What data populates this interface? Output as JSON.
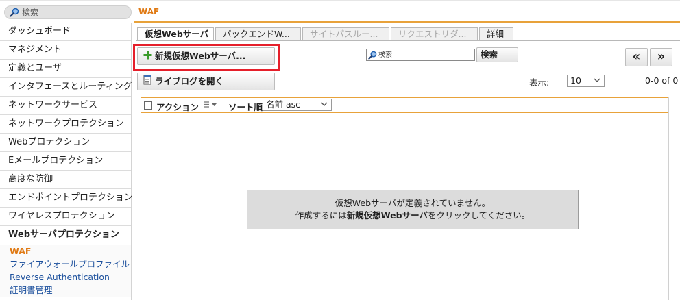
{
  "search": {
    "placeholder": "検索"
  },
  "page_title": "WAF",
  "sidebar": {
    "items": [
      {
        "label": "ダッシュボード"
      },
      {
        "label": "マネジメント"
      },
      {
        "label": "定義とユーザ"
      },
      {
        "label": "インタフェースとルーティング"
      },
      {
        "label": "ネットワークサービス"
      },
      {
        "label": "ネットワークプロテクション"
      },
      {
        "label": "Webプロテクション"
      },
      {
        "label": "Eメールプロテクション"
      },
      {
        "label": "高度な防御"
      },
      {
        "label": "エンドポイントプロテクション"
      },
      {
        "label": "ワイヤレスプロテクション"
      },
      {
        "label": "Webサーバプロテクション"
      }
    ],
    "subitems": [
      {
        "label": "WAF"
      },
      {
        "label": "ファイアウォールプロファイル"
      },
      {
        "label": "Reverse Authentication"
      },
      {
        "label": "証明書管理"
      }
    ]
  },
  "tabs": [
    {
      "label": "仮想Webサーバ"
    },
    {
      "label": "バックエンドW..."
    },
    {
      "label": "サイトパスルー..."
    },
    {
      "label": "リクエストリダ..."
    },
    {
      "label": "詳細"
    }
  ],
  "toolbar": {
    "new_server_label": "新規仮想Webサーバ...",
    "livelog_label": "ライブログを開く",
    "search_placeholder": "検索",
    "search_button": "検索",
    "first_page": "«",
    "prev_page": "»",
    "display_label": "表示:",
    "display_value": "10",
    "paging": "0-0 of 0"
  },
  "list": {
    "action_label": "アクション",
    "sort_label": "ソート順:",
    "sort_value": "名前 asc"
  },
  "empty": {
    "line1": "仮想Webサーバが定義されていません。",
    "line2_pre": "作成するには",
    "line2_bold": "新規仮想Webサーバ",
    "line2_post": "をクリックしてください。"
  },
  "colors": {
    "accent": "#e8a23a",
    "title": "#e07a14",
    "highlight": "#e51f2a",
    "link": "#1b4f9c"
  }
}
